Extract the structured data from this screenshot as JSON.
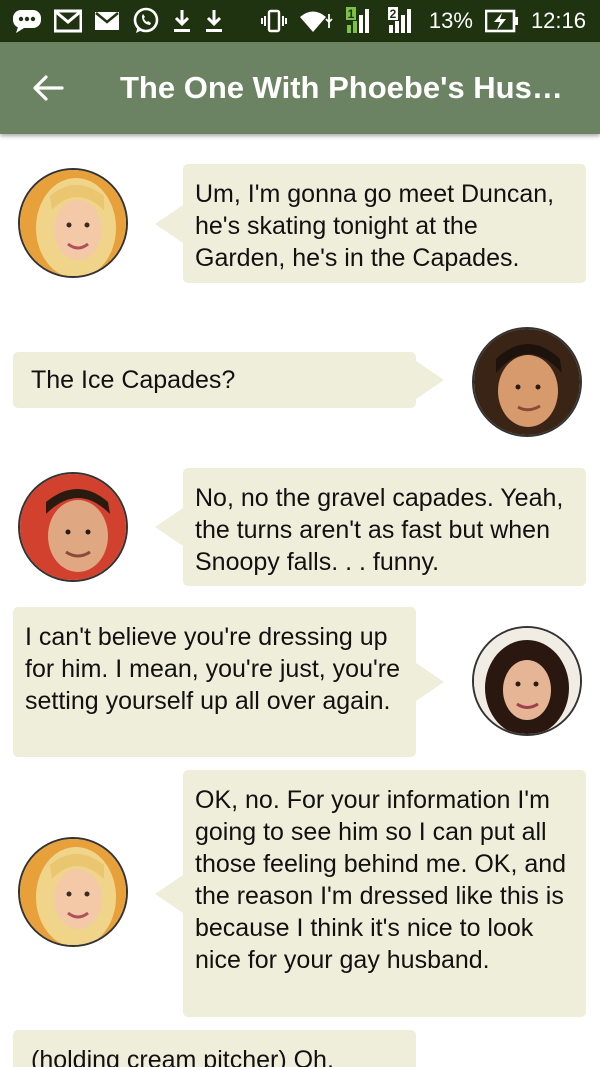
{
  "status_bar": {
    "battery_percent": "13%",
    "time": "12:16",
    "sim1": "1",
    "sim2": "2",
    "left_icons": [
      "chat-icon",
      "gmail-icon",
      "gmail-icon",
      "whatsapp-icon",
      "download-icon",
      "download-icon"
    ],
    "right_icons": [
      "vibrate-icon",
      "wifi-icon",
      "signal-icon",
      "signal-icon",
      "battery-charging-icon"
    ]
  },
  "app_bar": {
    "title": "The One With Phoebe's Husb...",
    "back_icon": "arrow-back-icon",
    "color": "#6c8363"
  },
  "messages": [
    {
      "speaker": "phoebe",
      "side": "left",
      "text": "Um, I'm gonna go meet Duncan, he's skating tonight at the Garden, he's in the Capades."
    },
    {
      "speaker": "joey",
      "side": "right",
      "text": "The Ice Capades?"
    },
    {
      "speaker": "chandler",
      "side": "left",
      "text": "No, no the gravel capades. Yeah, the turns aren't as fast but when Snoopy falls. . . funny."
    },
    {
      "speaker": "monica",
      "side": "right",
      "text": "I can't believe you're dressing up for him. I mean, you're just, you're setting yourself up all over again."
    },
    {
      "speaker": "phoebe",
      "side": "left",
      "text": "OK, no. For your information I'm going to see him so I can put all those feeling behind me. OK, and the reason I'm dressed like this is because I think it's nice to look nice for your gay husband."
    },
    {
      "speaker": "unknown",
      "side": "right",
      "text": "(holding cream pitcher) Oh,"
    }
  ],
  "colors": {
    "status_bar": "#1f3310",
    "bubble": "#efeedb"
  }
}
